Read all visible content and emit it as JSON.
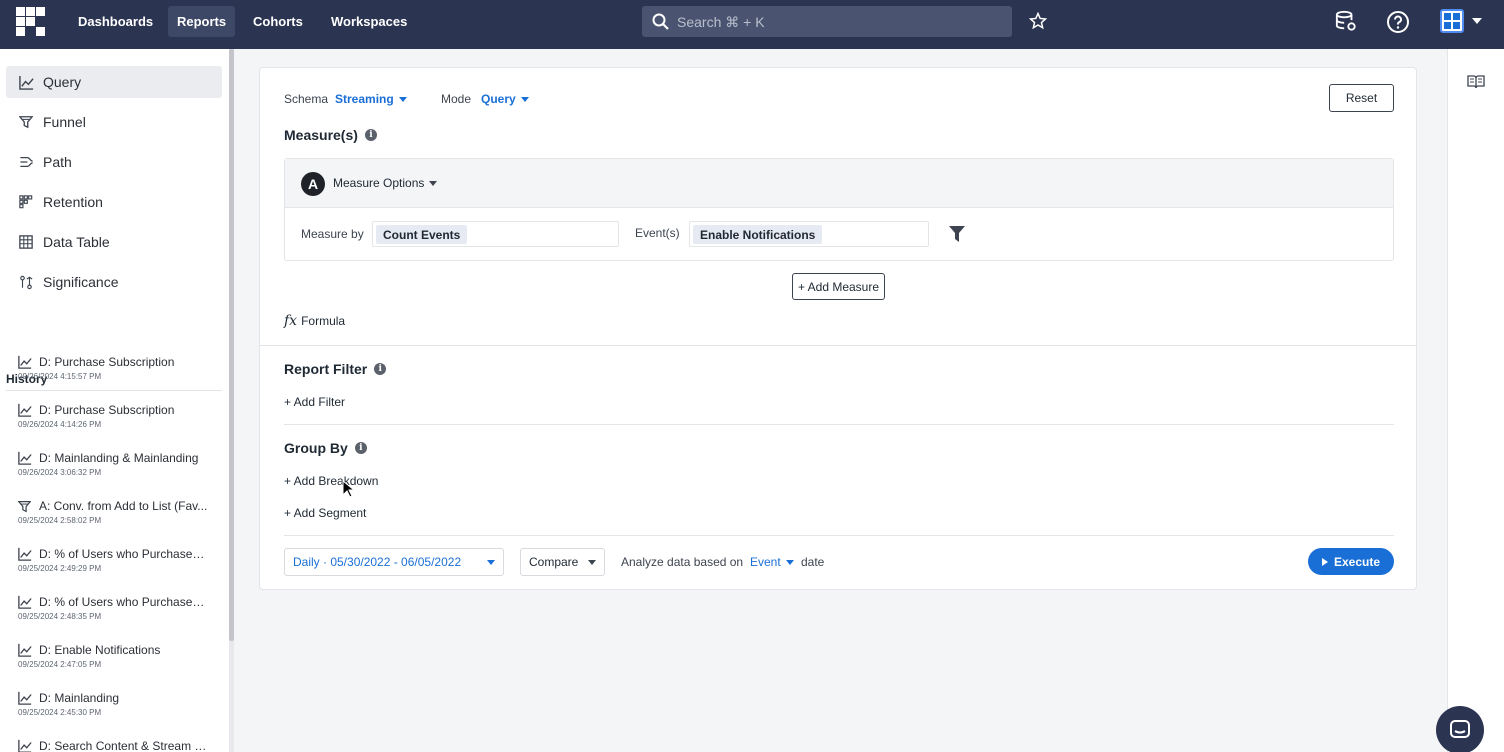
{
  "topbar": {
    "nav": [
      "Dashboards",
      "Reports",
      "Cohorts",
      "Workspaces"
    ],
    "active_nav": "Reports",
    "search_placeholder": "Search ⌘ + K"
  },
  "sidebar": {
    "items": [
      {
        "label": "Query",
        "icon": "line-chart-icon",
        "active": true
      },
      {
        "label": "Funnel",
        "icon": "funnel-icon",
        "active": false
      },
      {
        "label": "Path",
        "icon": "path-icon",
        "active": false
      },
      {
        "label": "Retention",
        "icon": "retention-icon",
        "active": false
      },
      {
        "label": "Data Table",
        "icon": "table-icon",
        "active": false
      },
      {
        "label": "Significance",
        "icon": "significance-icon",
        "active": false
      }
    ],
    "history_title": "History",
    "history": [
      {
        "label": "D: Purchase Subscription",
        "time": "09/26/2024 4:15:57 PM",
        "icon": "line-chart-icon"
      },
      {
        "label": "D: Purchase Subscription",
        "time": "09/26/2024 4:14:26 PM",
        "icon": "line-chart-icon"
      },
      {
        "label": "D: Mainlanding & Mainlanding",
        "time": "09/26/2024 3:06:32 PM",
        "icon": "line-chart-icon"
      },
      {
        "label": "A: Conv. from Add to List (Fav...",
        "time": "09/25/2024 2:58:02 PM",
        "icon": "funnel-icon"
      },
      {
        "label": "D: % of Users who Purchased ...",
        "time": "09/25/2024 2:49:29 PM",
        "icon": "line-chart-icon"
      },
      {
        "label": "D: % of Users who Purchased ...",
        "time": "09/25/2024 2:48:35 PM",
        "icon": "line-chart-icon"
      },
      {
        "label": "D: Enable Notifications",
        "time": "09/25/2024 2:47:05 PM",
        "icon": "line-chart-icon"
      },
      {
        "label": "D: Mainlanding",
        "time": "09/25/2024 2:45:30 PM",
        "icon": "line-chart-icon"
      },
      {
        "label": "D: Search Content & Stream C...",
        "time": "",
        "icon": "line-chart-icon"
      }
    ]
  },
  "query": {
    "schema_label": "Schema",
    "schema_value": "Streaming",
    "mode_label": "Mode",
    "mode_value": "Query",
    "reset_label": "Reset",
    "measures_title": "Measure(s)",
    "measure_badge": "A",
    "measure_options_label": "Measure Options",
    "measure_by_label": "Measure by",
    "measure_by_value": "Count Events",
    "events_label": "Event(s)",
    "events_value": "Enable Notifications",
    "add_measure_label": "+ Add Measure",
    "formula_symbol": "fx",
    "formula_label": "Formula",
    "report_filter_title": "Report Filter",
    "add_filter_label": "+ Add Filter",
    "group_by_title": "Group By",
    "add_breakdown_label": "+ Add Breakdown",
    "add_segment_label": "+ Add Segment",
    "date_range": "Daily · 05/30/2022 - 06/05/2022",
    "compare_label": "Compare",
    "analyze_label": "Analyze data based on",
    "analyze_value": "Event",
    "analyze_suffix": "date",
    "execute_label": "Execute"
  },
  "colors": {
    "topbar": "#2b3451",
    "accent": "#1a6fd6"
  }
}
